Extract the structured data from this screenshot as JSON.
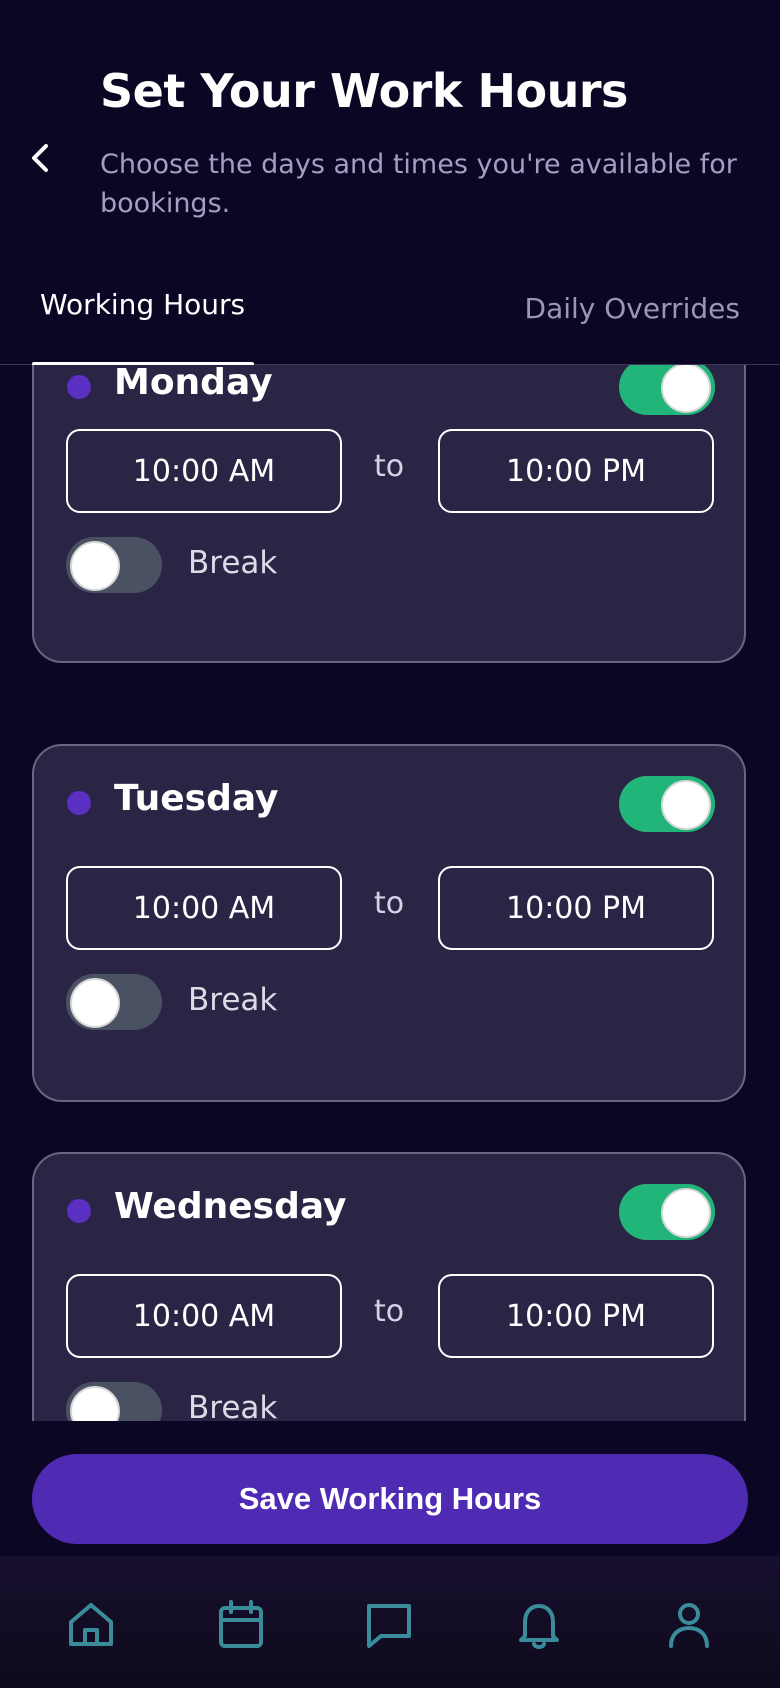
{
  "header": {
    "title": "Set Your Work Hours",
    "subtitle": "Choose the days and times you're available for bookings."
  },
  "tabs": [
    {
      "label": "Working Hours",
      "active": true
    },
    {
      "label": "Daily Overrides",
      "active": false
    }
  ],
  "days": [
    {
      "name": "Monday",
      "enabled": true,
      "start": "10:00 AM",
      "separator": "to",
      "end": "10:00 PM",
      "break_label": "Break",
      "break_enabled": false
    },
    {
      "name": "Tuesday",
      "enabled": true,
      "start": "10:00 AM",
      "separator": "to",
      "end": "10:00 PM",
      "break_label": "Break",
      "break_enabled": false
    },
    {
      "name": "Wednesday",
      "enabled": true,
      "start": "10:00 AM",
      "separator": "to",
      "end": "10:00 PM",
      "break_label": "Break",
      "break_enabled": false
    }
  ],
  "save_button": {
    "label": "Save Working Hours"
  },
  "bottom_nav": {
    "icons": [
      "home-icon",
      "calendar-icon",
      "chat-icon",
      "bell-icon",
      "user-icon"
    ],
    "icon_color": "#3b8c9a"
  },
  "colors": {
    "background": "#0b0624",
    "card": "#2b2545",
    "toggle_on": "#22b57a",
    "toggle_off": "#4a5163",
    "accent": "#4f2bb4",
    "day_dot": "#5a2fc2"
  }
}
